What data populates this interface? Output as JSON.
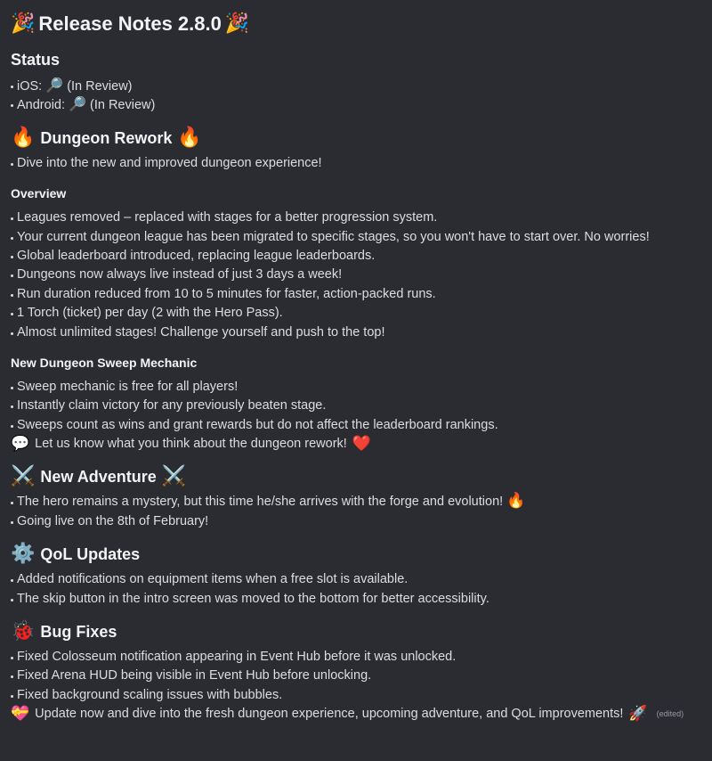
{
  "title": {
    "text": "Release Notes 2.8.0",
    "icon_left": "🎉",
    "icon_right": "🎉"
  },
  "status": {
    "heading": "Status",
    "items": [
      {
        "platform": "iOS:",
        "icon": "🔎",
        "state": "(In Review)"
      },
      {
        "platform": "Android:",
        "icon": "🔎",
        "state": "(In Review)"
      }
    ]
  },
  "dungeon": {
    "heading": "Dungeon Rework",
    "icon": "🔥",
    "intro": [
      "Dive into the new and improved dungeon experience!"
    ],
    "overview": {
      "heading": "Overview",
      "items": [
        "Leagues removed – replaced with stages for a better progression system.",
        "Your current dungeon league has been migrated to specific stages, so you won't have to start over. No worries!",
        "Global leaderboard introduced, replacing league leaderboards.",
        "Dungeons now always live instead of just 3 days a week!",
        "Run duration reduced from 10 to 5 minutes for faster, action-packed runs.",
        "1 Torch (ticket) per day (2 with the Hero Pass).",
        "Almost unlimited stages! Challenge yourself and push to the top!"
      ]
    },
    "sweep": {
      "heading": "New Dungeon Sweep Mechanic",
      "items": [
        "Sweep mechanic is free for all players!",
        "Instantly claim victory for any previously beaten stage.",
        "Sweeps count as wins and grant rewards but do not affect the leaderboard rankings."
      ],
      "feedback_icon": "💬",
      "feedback_text": "Let us know what you think about the dungeon rework!",
      "feedback_heart": "❤️"
    }
  },
  "adventure": {
    "heading": "New Adventure",
    "icon": "⚔️",
    "items": [
      "The hero remains a mystery, but this time he/she arrives with the forge and evolution!",
      "Going live on the 8th of February!"
    ],
    "item0_trailing_icon": "🔥"
  },
  "qol": {
    "heading": "QoL Updates",
    "icon": "⚙️",
    "items": [
      "Added notifications on equipment items when a free slot is available.",
      "The skip button in the intro screen was moved to the bottom for better accessibility."
    ]
  },
  "bugs": {
    "heading": "Bug Fixes",
    "icon": "🐞",
    "items": [
      "Fixed Colosseum notification appearing in  Event Hub before it was unlocked.",
      "Fixed Arena HUD being visible in Event Hub before unlocking.",
      "Fixed background scaling issues with bubbles."
    ]
  },
  "footer": {
    "icon": "💝",
    "text": "Update now and dive into the fresh dungeon experience, upcoming adventure, and QoL improvements!",
    "trailing_icon": "🚀",
    "edited_label": "(edited)"
  }
}
